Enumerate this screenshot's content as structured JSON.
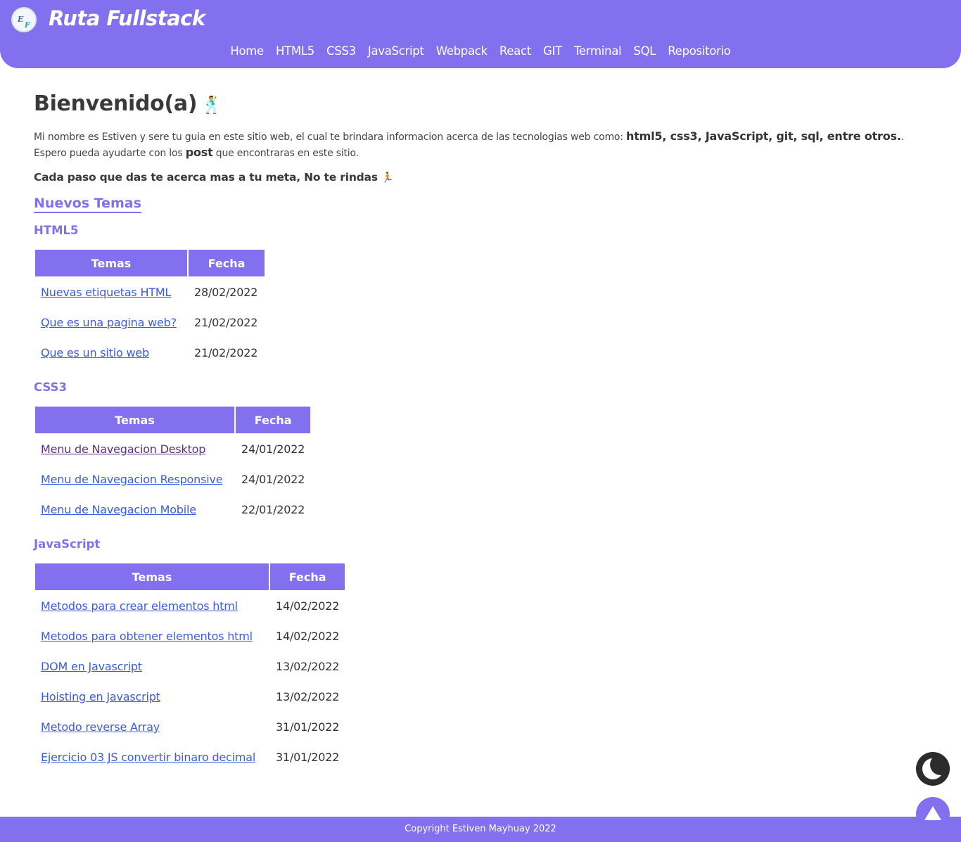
{
  "header": {
    "logo_text_e": "E",
    "logo_text_f": "F",
    "title": "Ruta Fullstack",
    "nav": [
      "Home",
      "HTML5",
      "CSS3",
      "JavaScript",
      "Webpack",
      "React",
      "GIT",
      "Terminal",
      "SQL",
      "Repositorio"
    ]
  },
  "main": {
    "heading": "Bienvenido(a)",
    "heading_emoji": "🕺",
    "intro_pre": "Mi nombre es Estiven y sere tu guia en este sitio web, el cual te brindara informacion acerca de las tecnologias web como: ",
    "intro_strong": "html5, css3, JavaScript, git, sql, entre otros.",
    "intro_mid": ". Espero pueda ayudarte con los ",
    "intro_post": "post",
    "intro_end": " que encontraras en este sitio.",
    "motto": "Cada paso que das te acerca mas a tu meta, No te rindas",
    "motto_emoji": "🏃",
    "new_topics": "Nuevos Temas"
  },
  "sections": [
    {
      "title": "HTML5",
      "col_topics": "Temas",
      "col_date": "Fecha",
      "rows": [
        {
          "topic": "Nuevas etiquetas HTML",
          "date": "28/02/2022"
        },
        {
          "topic": "Que es una pagina web?",
          "date": "21/02/2022"
        },
        {
          "topic": "Que es un sitio web",
          "date": "21/02/2022"
        }
      ]
    },
    {
      "title": "CSS3",
      "col_topics": "Temas",
      "col_date": "Fecha",
      "rows": [
        {
          "topic": "Menu de Navegacion Desktop",
          "date": "24/01/2022"
        },
        {
          "topic": "Menu de Navegacion Responsive",
          "date": "24/01/2022"
        },
        {
          "topic": "Menu de Navegacion Mobile",
          "date": "22/01/2022"
        }
      ]
    },
    {
      "title": "JavaScript",
      "col_topics": "Temas",
      "col_date": "Fecha",
      "rows": [
        {
          "topic": "Metodos para crear elementos html",
          "date": "14/02/2022"
        },
        {
          "topic": "Metodos para obtener elementos html",
          "date": "14/02/2022"
        },
        {
          "topic": "DOM en Javascript",
          "date": "13/02/2022"
        },
        {
          "topic": "Hoisting en Javascript",
          "date": "13/02/2022"
        },
        {
          "topic": "Metodo reverse Array",
          "date": "31/01/2022"
        },
        {
          "topic": "Ejercicio 03 JS convertir binaro decimal",
          "date": "31/01/2022"
        }
      ]
    }
  ],
  "buttons": {
    "theme_icon": "moon-icon",
    "top_icon": "arrow-up-icon"
  },
  "footer": {
    "copyright": "Copyright Estiven Mayhuay 2022"
  },
  "colors": {
    "primary": "#8370ee",
    "link": "#3b5ddd",
    "visited_link": "#5c2f82"
  }
}
